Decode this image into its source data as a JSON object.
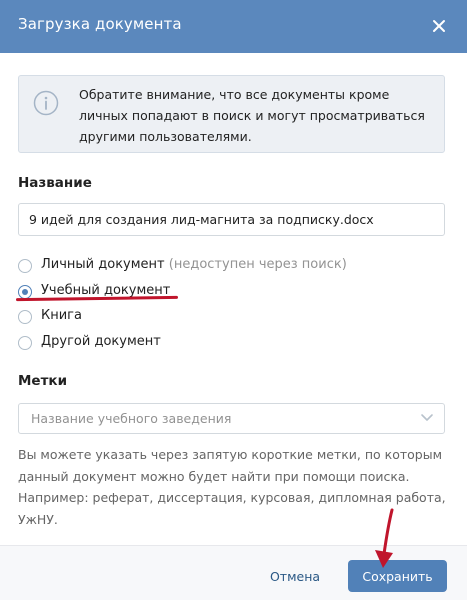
{
  "dialog": {
    "title": "Загрузка документа"
  },
  "notice": {
    "text": "Обратите внимание, что все документы кроме личных попадают в поиск и могут просматриваться другими пользователями."
  },
  "name_field": {
    "label": "Название",
    "value": "9 идей для создания лид-магнита за подписку.docx"
  },
  "doc_type": {
    "options": [
      {
        "label": "Личный документ",
        "note": "(недоступен через поиск)",
        "checked": false
      },
      {
        "label": "Учебный документ",
        "note": "",
        "checked": true
      },
      {
        "label": "Книга",
        "note": "",
        "checked": false
      },
      {
        "label": "Другой документ",
        "note": "",
        "checked": false
      }
    ]
  },
  "tags": {
    "label": "Метки",
    "placeholder": "Название учебного заведения",
    "hint": "Вы можете указать через запятую короткие метки, по которым данный документ можно будет найти при помощи поиска. Например: реферат, диссертация, курсовая, дипломная работа, УжНУ."
  },
  "footer": {
    "cancel_label": "Отмена",
    "save_label": "Сохранить"
  },
  "colors": {
    "header": "#5b88bd",
    "primary_button": "#5181b8",
    "annotation": "#c0152c"
  },
  "icons": {
    "close": "close-icon",
    "info": "info-icon",
    "chevron": "chevron-down-icon"
  }
}
